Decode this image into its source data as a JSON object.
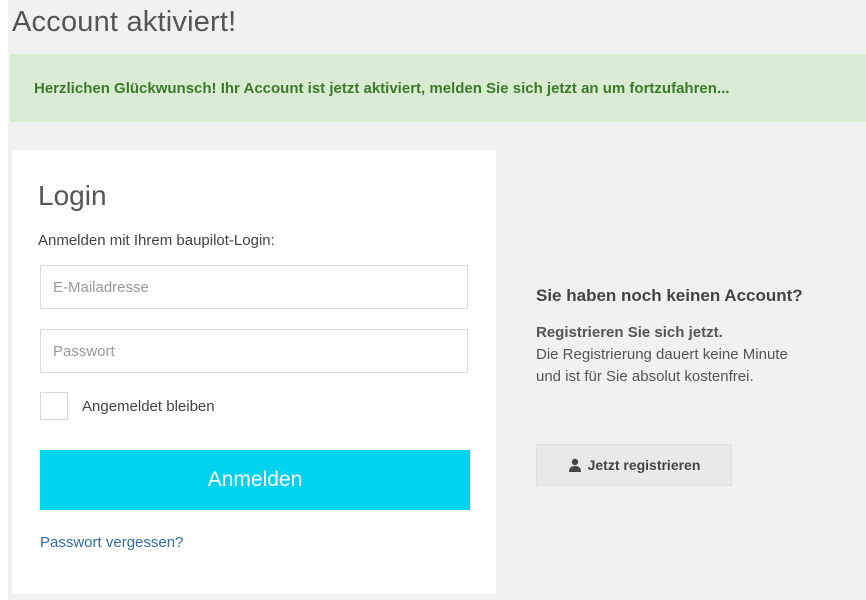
{
  "page": {
    "title": "Account aktiviert!"
  },
  "alert": {
    "message": "Herzlichen Glückwunsch! Ihr Account ist jetzt aktiviert, melden Sie sich jetzt an um fortzufahren...",
    "background": "#d9ecd3",
    "text_color": "#3c7a2a"
  },
  "login": {
    "title": "Login",
    "subtitle": "Anmelden mit Ihrem baupilot-Login:",
    "email": {
      "value": "",
      "placeholder": "E-Mailadresse"
    },
    "password": {
      "value": "",
      "placeholder": "Passwort"
    },
    "remember_label": "Angemeldet bleiben",
    "remember_checked": false,
    "submit_label": "Anmelden",
    "submit_color": "#00d3ef",
    "forgot_label": "Passwort vergessen?"
  },
  "register": {
    "heading": "Sie haben noch keinen Account?",
    "bold_line": "Registrieren Sie sich jetzt.",
    "text_line1": "Die Registrierung dauert keine Minute",
    "text_line2": "und ist für Sie absolut kostenfrei.",
    "button_label": "Jetzt registrieren",
    "button_icon": "user-icon"
  }
}
